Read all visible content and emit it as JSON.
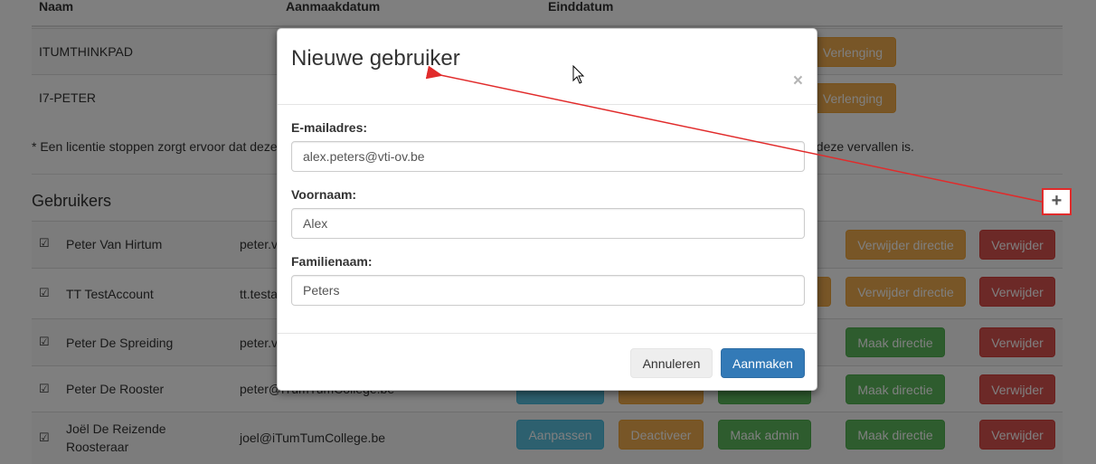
{
  "licenses": {
    "headers": {
      "name": "Naam",
      "created": "Aanmaakdatum",
      "end": "Einddatum"
    },
    "rows": [
      {
        "name": "ITUMTHINKPAD",
        "action": "Verlenging"
      },
      {
        "name": "I7-PETER",
        "action": "Verlenging"
      }
    ],
    "note_start": "* Een licentie stoppen zorgt ervoor dat deze",
    "note_end": "t deze vervallen is."
  },
  "users": {
    "title": "Gebruikers",
    "add_icon": "plus-icon",
    "rows": [
      {
        "name": "Peter Van Hirtum",
        "email": "peter.v",
        "buttons": [
          "Verwijder directie",
          "Verwijder"
        ]
      },
      {
        "name": "TT TestAccount",
        "email": "tt.testa",
        "buttons": [
          "Verwijder directie",
          "Verwijder"
        ]
      },
      {
        "name": "Peter De Spreiding",
        "email": "peter.v",
        "buttons": [
          "Maak directie",
          "Verwijder"
        ]
      },
      {
        "name": "Peter De Rooster",
        "email": "peter@iTumTumCollege.be",
        "buttons": [
          "Maak directie",
          "Verwijder"
        ]
      },
      {
        "name": "Joël De Reizende Roosteraar",
        "email": "joel@iTumTumCollege.be",
        "buttons": [
          "Aanpassen",
          "Deactiveer",
          "Maak admin",
          "Maak directie",
          "Verwijder"
        ]
      }
    ]
  },
  "modal": {
    "title": "Nieuwe gebruiker",
    "close": "×",
    "fields": {
      "email_label": "E-mailadres:",
      "email_value": "alex.peters@vti-ov.be",
      "first_label": "Voornaam:",
      "first_value": "Alex",
      "last_label": "Familienaam:",
      "last_value": "Peters"
    },
    "cancel": "Annuleren",
    "create": "Aanmaken"
  },
  "colors": {
    "primary": "#337ab7",
    "warning": "#f0ad4e",
    "danger": "#d9534f",
    "success": "#5cb85c",
    "info": "#5bc0de",
    "annotation": "#e12b2b"
  }
}
